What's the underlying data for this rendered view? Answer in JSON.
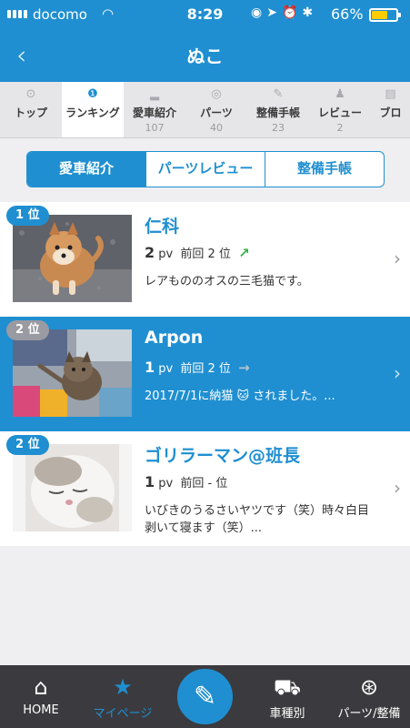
{
  "status": {
    "carrier": "docomo",
    "time": "8:29",
    "battery_pct": "66%",
    "battery_level": 0.62
  },
  "nav": {
    "back_icon": "chevron-left-icon",
    "title": "ぬこ"
  },
  "tabs": [
    {
      "label": "トップ",
      "count": "",
      "icon": "top-icon"
    },
    {
      "label": "ランキング",
      "count": "",
      "icon": "ranking-icon",
      "active": true
    },
    {
      "label": "愛車紹介",
      "count": "107",
      "icon": "car-icon"
    },
    {
      "label": "パーツ",
      "count": "40",
      "icon": "steering-icon"
    },
    {
      "label": "整備手帳",
      "count": "23",
      "icon": "wrench-icon"
    },
    {
      "label": "レビュー",
      "count": "2",
      "icon": "review-icon"
    },
    {
      "label": "ブロ",
      "count": "",
      "icon": "blog-icon"
    }
  ],
  "segment": [
    "愛車紹介",
    "パーツレビュー",
    "整備手帳"
  ],
  "rows": [
    {
      "rank": "1 位",
      "name": "仁科",
      "pv": "2",
      "pv_unit": "pv",
      "prev": "前回 2 位",
      "trend": "↗",
      "trend_color": "#38b24a",
      "desc": "レアもののオスの三毛猫です。"
    },
    {
      "rank": "2 位",
      "name": "Arpon",
      "pv": "1",
      "pv_unit": "pv",
      "prev": "前回 2 位",
      "trend": "→",
      "trend_color": "#b9c3cb",
      "desc": "2017/7/1に納猫 🐱 されました。..."
    },
    {
      "rank": "2 位",
      "name": "ゴリラーマン@班長",
      "pv": "1",
      "pv_unit": "pv",
      "prev": "前回 - 位",
      "trend": "",
      "trend_color": "",
      "desc": "いびきのうるさいヤツです（笑）時々白目剥いて寝ます（笑）..."
    }
  ],
  "bottom": [
    {
      "label": "HOME",
      "icon": "home-icon"
    },
    {
      "label": "マイページ",
      "icon": "star-icon",
      "active": true
    },
    {
      "label": "",
      "icon": "pencil-icon"
    },
    {
      "label": "車種別",
      "icon": "car-front-icon"
    },
    {
      "label": "パーツ/整備",
      "icon": "wheel-icon"
    }
  ],
  "colors": {
    "accent": "#1f8fd1",
    "bar": "#3b3b3f"
  }
}
